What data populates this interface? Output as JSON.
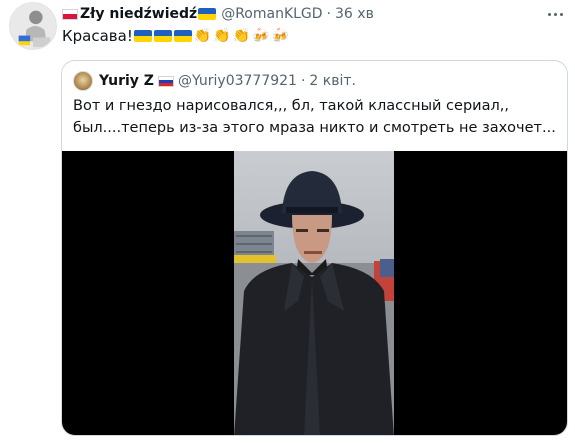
{
  "tweet": {
    "display_name": "Zły niedźwiedź",
    "handle": "@RomanKLGD",
    "separator": "·",
    "time": "36 хв",
    "text": "Красава!",
    "flags": [
      "ukraine-flag",
      "ukraine-flag",
      "ukraine-flag"
    ],
    "emoji_claps": [
      "clapping-hands",
      "clapping-hands",
      "clapping-hands"
    ],
    "emoji_beers": [
      "beer-mugs",
      "beer-mugs"
    ]
  },
  "quote": {
    "display_name": "Yuriy Z",
    "handle": "@Yuriy03777921",
    "separator": "·",
    "date": "2 квіт.",
    "text": "Вот и гнездо нарисовался,,, бл, такой классный сериал,, был....теперь из-за этого мраза никто и смотреть не захочет..."
  },
  "colors": {
    "text_primary": "#0f1419",
    "text_secondary": "#536471",
    "border": "#cfd9de",
    "media_bg": "#000000"
  }
}
